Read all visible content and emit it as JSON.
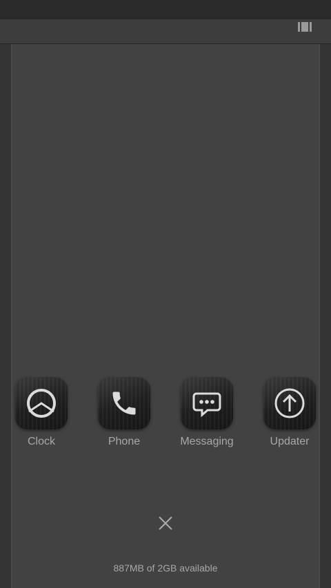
{
  "apps": [
    {
      "label": "Clock",
      "icon": "clock-icon"
    },
    {
      "label": "Phone",
      "icon": "phone-icon"
    },
    {
      "label": "Messaging",
      "icon": "message-bubble-icon"
    },
    {
      "label": "Updater",
      "icon": "up-arrow-circle-icon"
    }
  ],
  "close_icon": "close-icon",
  "memory_status": "887MB of 2GB available",
  "colors": {
    "background": "#424242",
    "text": "#a8a8a8",
    "icon": "#dcdcdc"
  }
}
